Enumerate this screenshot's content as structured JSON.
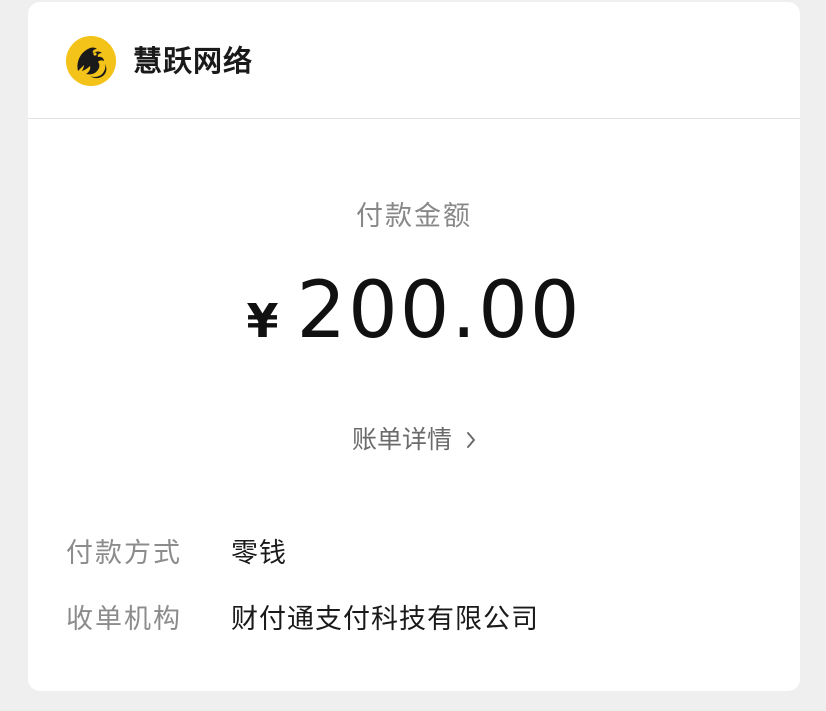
{
  "merchant": {
    "name": "慧跃网络",
    "logo_icon": "dragon-logo-icon",
    "logo_bg": "#f4c31a"
  },
  "payment": {
    "amount_label": "付款金额",
    "currency_symbol": "¥",
    "amount": "200.00",
    "bill_details_label": "账单详情",
    "bill_details_icon": "chevron-right-icon"
  },
  "details": [
    {
      "label": "付款方式",
      "value": "零钱"
    },
    {
      "label": "收单机构",
      "value": "财付通支付科技有限公司"
    }
  ]
}
